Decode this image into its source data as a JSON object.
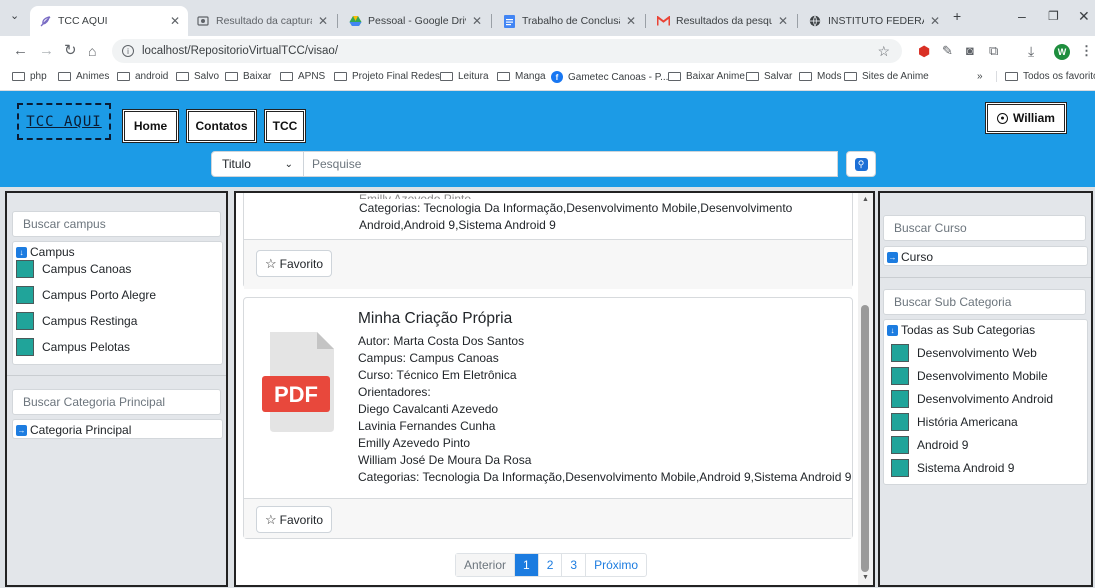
{
  "browser": {
    "tabs": [
      {
        "label": "TCC AQUI",
        "icon": "feather-icon"
      },
      {
        "label": "Resultado da captura de te",
        "icon": "image-icon"
      },
      {
        "label": "Pessoal - Google Drive",
        "icon": "drive-icon"
      },
      {
        "label": "Trabalho de Conclusão de",
        "icon": "docs-icon"
      },
      {
        "label": "Resultados da pesquisa - v",
        "icon": "gmail-icon"
      },
      {
        "label": "INSTITUTO FEDERAL DO R",
        "icon": "globe-icon"
      }
    ],
    "new_tab": "+",
    "url": "localhost/RepositorioVirtualTCC/visao/",
    "profile_initial": "W",
    "bookmarks": [
      "php",
      "Animes",
      "android",
      "Salvo",
      "Baixar",
      "APNS",
      "Projeto Final Redes",
      "Leitura",
      "Manga",
      "Gametec Canoas - P...",
      "Baixar Anime",
      "Salvar",
      "Mods",
      "Sites de Anime"
    ],
    "bookmarks_more": "»",
    "all_bookmarks": "Todos os favoritos"
  },
  "header": {
    "logo": "TCC AQUI",
    "nav": {
      "home": "Home",
      "contatos": "Contatos",
      "tcc": "TCC"
    },
    "user": "William",
    "search": {
      "field": "Titulo",
      "placeholder": "Pesquise"
    }
  },
  "left_sidebar": {
    "campus_search": "Buscar campus",
    "campus_header": "Campus",
    "campus_items": [
      "Campus Canoas",
      "Campus Porto Alegre",
      "Campus Restinga",
      "Campus Pelotas"
    ],
    "category_search": "Buscar Categoria Principal",
    "category_header": "Categoria Principal"
  },
  "right_sidebar": {
    "course_search": "Buscar Curso",
    "course_header": "Curso",
    "subcat_search": "Buscar Sub Categoria",
    "subcat_header": "Todas as Sub Categorias",
    "subcat_items": [
      "Desenvolvimento Web",
      "Desenvolvimento Mobile",
      "Desenvolvimento Android",
      "História Americana",
      "Android 9",
      "Sistema Android 9"
    ]
  },
  "results": {
    "card1": {
      "partial_author": "Emilly Azevedo Pinto",
      "categories": [
        "Categorias: Tecnologia Da Informação,Desenvolvimento Mobile,Desenvolvimento",
        "Android,Android 9,Sistema Android 9"
      ],
      "fav": "Favorito"
    },
    "card2": {
      "title": "Minha Criação Própria",
      "thumb_label": "PDF",
      "author": "Autor: Marta Costa Dos Santos",
      "campus": "Campus: Campus Canoas",
      "course": "Curso: Técnico Em Eletrônica",
      "advisors_label": "Orientadores:",
      "advisors": [
        "Diego Cavalcanti Azevedo",
        "Lavinia Fernandes Cunha",
        "Emilly Azevedo Pinto",
        "William José De Moura Da Rosa"
      ],
      "categories": "Categorias: Tecnologia Da Informação,Desenvolvimento Mobile,Android 9,Sistema Android 9",
      "fav": "Favorito"
    },
    "pagination": {
      "prev": "Anterior",
      "pages": [
        "1",
        "2",
        "3"
      ],
      "active_page": "1",
      "next": "Próximo"
    }
  },
  "colors": {
    "header_bg": "#1c9be6",
    "accent": "#1c7ce0",
    "checkbox": "#20a49a",
    "pdf_red": "#e8483c"
  }
}
